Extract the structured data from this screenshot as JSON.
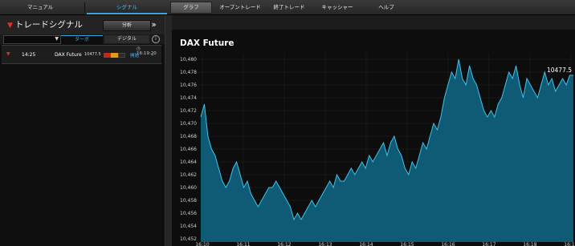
{
  "nav": {
    "tabs": [
      {
        "label": "マニュアル"
      },
      {
        "label": "シグナル"
      },
      {
        "label": "グラフ"
      },
      {
        "label": "オープントレード"
      },
      {
        "label": "終了トレード"
      },
      {
        "label": "キャッシャー"
      },
      {
        "label": "ヘルプ"
      }
    ]
  },
  "left": {
    "title": "トレードシグナル",
    "analysis_label": "分析",
    "mode_turbo": "ターボ",
    "mode_digital": "デジタル",
    "info_label": "i",
    "signal": {
      "time": "14:25",
      "clock": "16:19:20",
      "instrument": "DAX Future",
      "price": "10477.5",
      "action": "開始",
      "chevron": "»"
    }
  },
  "chart_title": "DAX Future",
  "chart_data": {
    "type": "area",
    "title": "DAX Future",
    "ylim": [
      10451.5,
      10481
    ],
    "yticks": [
      10452,
      10454,
      10456,
      10458,
      10460,
      10462,
      10464,
      10466,
      10468,
      10470,
      10472,
      10474,
      10476,
      10478,
      10480
    ],
    "ytick_labels": [
      "10,452",
      "10,454",
      "10,456",
      "10,458",
      "10,460",
      "10,462",
      "10,464",
      "10,466",
      "10,468",
      "10,470",
      "10,472",
      "10,474",
      "10,476",
      "10,478",
      "10,480"
    ],
    "xtick_labels": [
      "16:10",
      "16:11",
      "16:12",
      "16:13",
      "16:14",
      "16:15",
      "16:16",
      "16:17",
      "16:18",
      "16:19"
    ],
    "last_label": "10477.5",
    "series": [
      {
        "values": [
          10471,
          10473,
          10468,
          10466,
          10465,
          10463,
          10461,
          10460,
          10461,
          10463,
          10464,
          10462,
          10460,
          10461,
          10459,
          10458,
          10457,
          10458,
          10459,
          10460,
          10460,
          10461,
          10460,
          10459,
          10458,
          10457,
          10455,
          10456,
          10455,
          10456,
          10457,
          10458,
          10457,
          10458,
          10459,
          10460,
          10461,
          10460,
          10462,
          10461,
          10461,
          10462,
          10463,
          10462,
          10463,
          10464,
          10463,
          10465,
          10464,
          10465,
          10466,
          10467,
          10465,
          10467,
          10468,
          10466,
          10465,
          10463,
          10462,
          10464,
          10463,
          10465,
          10467,
          10466,
          10468,
          10470,
          10469,
          10471,
          10474,
          10476,
          10478,
          10477,
          10480,
          10477,
          10476,
          10479,
          10477,
          10476,
          10474,
          10472,
          10471,
          10472,
          10471,
          10473,
          10474,
          10476,
          10478,
          10477,
          10479,
          10476,
          10474,
          10477,
          10476,
          10475,
          10474,
          10476,
          10478,
          10476,
          10477,
          10475,
          10476,
          10477,
          10476,
          10477.5,
          10477.5
        ]
      }
    ]
  }
}
